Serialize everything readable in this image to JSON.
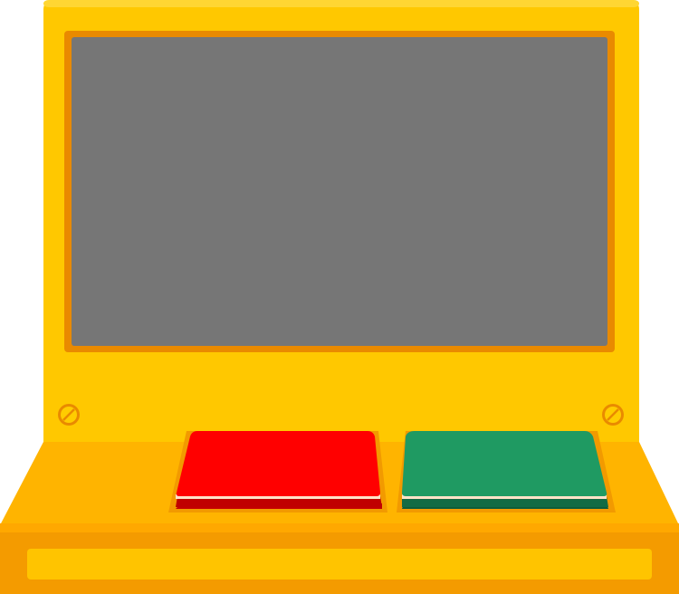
{
  "machine": {
    "colors": {
      "body_main": "#FFC800",
      "body_shadow": "#FFB000",
      "body_outline": "#E98A00",
      "screen_border": "#E98A00",
      "screen_fill": "#767676",
      "deck_light": "#FFB400",
      "deck_dark": "#F49B00",
      "red_button": "#FF0000",
      "red_button_base": "#D20000",
      "green_button": "#1F9A62",
      "green_button_base": "#126B44",
      "screw": "#FFCC00"
    },
    "screen": {
      "content": ""
    },
    "buttons": [
      {
        "name": "red",
        "color": "#FF0000",
        "label": ""
      },
      {
        "name": "green",
        "color": "#1F9A62",
        "label": ""
      }
    ]
  }
}
